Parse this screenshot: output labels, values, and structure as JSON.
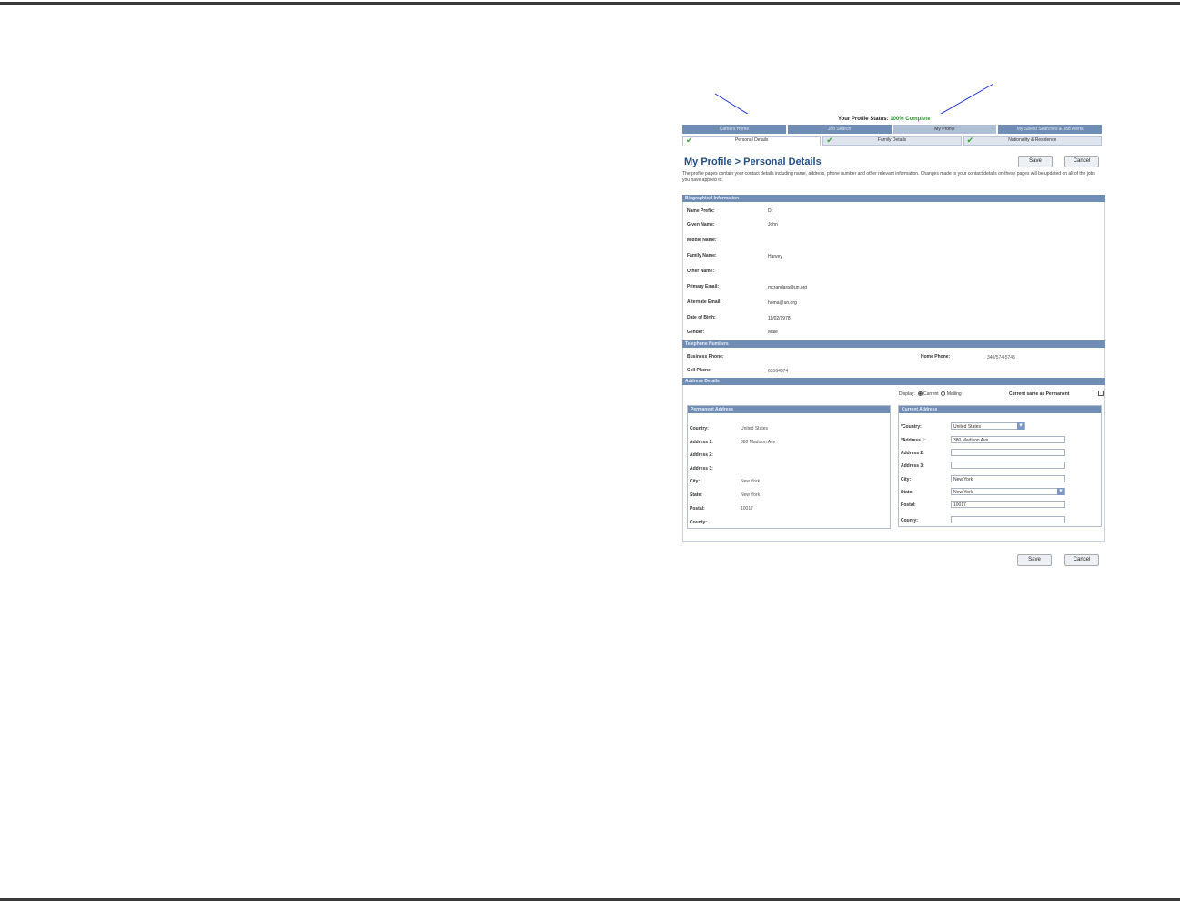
{
  "profile_status": {
    "label": "Your Profile Status:",
    "value": "100% Complete"
  },
  "main_tabs": [
    "Careers Home",
    "Job Search",
    "My Profile",
    "My Saved Searches & Job Alerts"
  ],
  "sub_tabs": [
    "Personal Details",
    "Family Details",
    "Nationality & Residence"
  ],
  "page_title": "My Profile > Personal Details",
  "buttons": {
    "save": "Save",
    "cancel": "Cancel"
  },
  "intro": "The profile pages contain your contact details including name, address, phone number and other relevant information. Changes made to your contact details on these pages will be updated on all of the jobs you have applied to.",
  "bio": {
    "title": "Biographical Information",
    "fields": [
      {
        "label": "Name Prefix:",
        "value": "Dr"
      },
      {
        "label": "Given Name:",
        "value": "John"
      },
      {
        "label": "Middle Name:",
        "value": ""
      },
      {
        "label": "Family Name:",
        "value": "Harvey"
      },
      {
        "label": "Other Name:",
        "value": ""
      },
      {
        "label": "Primary Email:",
        "value": "mcrandara@un.org"
      },
      {
        "label": "Alternate Email:",
        "value": "homa@un.org"
      },
      {
        "label": "Date of Birth:",
        "value": "11/02/1978"
      },
      {
        "label": "Gender:",
        "value": "Male"
      }
    ]
  },
  "phone": {
    "title": "Telephone Numbers",
    "business_label": "Business Phone:",
    "business_value": "",
    "home_label": "Home Phone:",
    "home_value": "340/574-5745",
    "cell_label": "Cell Phone:",
    "cell_value": "63564574"
  },
  "address": {
    "title": "Address Details",
    "display_label": "Display:",
    "opt_current": "Current",
    "opt_mailing": "Mailing",
    "same_label": "Current same as Permanent",
    "permanent": {
      "title": "Permanent Address",
      "fields": [
        {
          "label": "Country:",
          "value": "United States"
        },
        {
          "label": "Address 1:",
          "value": "380 Madison Ave"
        },
        {
          "label": "Address 2:",
          "value": ""
        },
        {
          "label": "Address 3:",
          "value": ""
        },
        {
          "label": "City:",
          "value": "New York"
        },
        {
          "label": "State:",
          "value": "New York"
        },
        {
          "label": "Postal:",
          "value": "10017"
        },
        {
          "label": "County:",
          "value": ""
        }
      ]
    },
    "current": {
      "title": "Current Address",
      "fields": [
        {
          "label": "*Country:",
          "value": "United States"
        },
        {
          "label": "*Address 1:",
          "value": "380 Madison Ave"
        },
        {
          "label": "Address 2:",
          "value": ""
        },
        {
          "label": "Address 3:",
          "value": ""
        },
        {
          "label": "City:",
          "value": "New York"
        },
        {
          "label": "State:",
          "value": "New York"
        },
        {
          "label": "Postal:",
          "value": "10017"
        },
        {
          "label": "County:",
          "value": ""
        }
      ]
    }
  },
  "colors": {
    "header_bar": "#6f8db5",
    "title": "#224f8a",
    "status": "#2e9a2e",
    "annotation": "#1a2fd6"
  }
}
